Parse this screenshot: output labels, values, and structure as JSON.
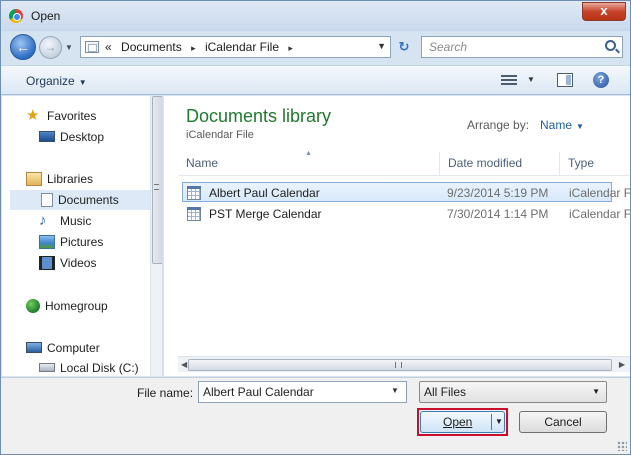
{
  "window": {
    "title": "Open",
    "close_glyph": "x"
  },
  "nav": {
    "back_glyph": "←",
    "forward_glyph": "→",
    "history_glyph": "▼",
    "address": {
      "overflow": "«",
      "crumbs": [
        "Documents",
        "iCalendar File"
      ],
      "separator": "▸",
      "dropdown_glyph": "▼"
    },
    "refresh_glyph": "↻",
    "search_placeholder": "Search"
  },
  "toolbar": {
    "organize_label": "Organize",
    "caret": "▼",
    "help_glyph": "?"
  },
  "sidebar": {
    "items": [
      {
        "label": "Favorites",
        "icon": "star-icon"
      },
      {
        "label": "Desktop",
        "icon": "desktop-icon"
      },
      {
        "label": "Libraries",
        "icon": "library-icon"
      },
      {
        "label": "Documents",
        "icon": "documents-icon",
        "selected": true
      },
      {
        "label": "Music",
        "icon": "music-icon"
      },
      {
        "label": "Pictures",
        "icon": "pictures-icon"
      },
      {
        "label": "Videos",
        "icon": "videos-icon"
      },
      {
        "label": "Homegroup",
        "icon": "homegroup-icon"
      },
      {
        "label": "Computer",
        "icon": "computer-icon"
      },
      {
        "label": "Local Disk (C:)",
        "icon": "disk-icon"
      }
    ]
  },
  "library": {
    "title": "Documents library",
    "subtitle": "iCalendar File",
    "arrange_label": "Arrange by:",
    "arrange_value": "Name"
  },
  "table": {
    "columns": [
      "Name",
      "Date modified",
      "Type"
    ],
    "sort_glyph": "▲",
    "rows": [
      {
        "name": "Albert Paul Calendar",
        "date": "9/23/2014 5:19 PM",
        "type": "iCalendar File",
        "selected": true
      },
      {
        "name": "PST Merge Calendar",
        "date": "7/30/2014 1:14 PM",
        "type": "iCalendar File",
        "selected": false
      }
    ],
    "scroll_left": "◀",
    "scroll_right": "▶"
  },
  "footer": {
    "filename_label": "File name:",
    "filename_value": "Albert Paul Calendar",
    "dropdown_glyph": "▼",
    "filter_value": "All Files",
    "open_label": "Open",
    "cancel_label": "Cancel"
  },
  "colors": {
    "library_title": "#1e7a2c",
    "link_blue": "#1e5ea8",
    "highlight_outline": "#c8102e",
    "selection_border": "#84acdd"
  }
}
